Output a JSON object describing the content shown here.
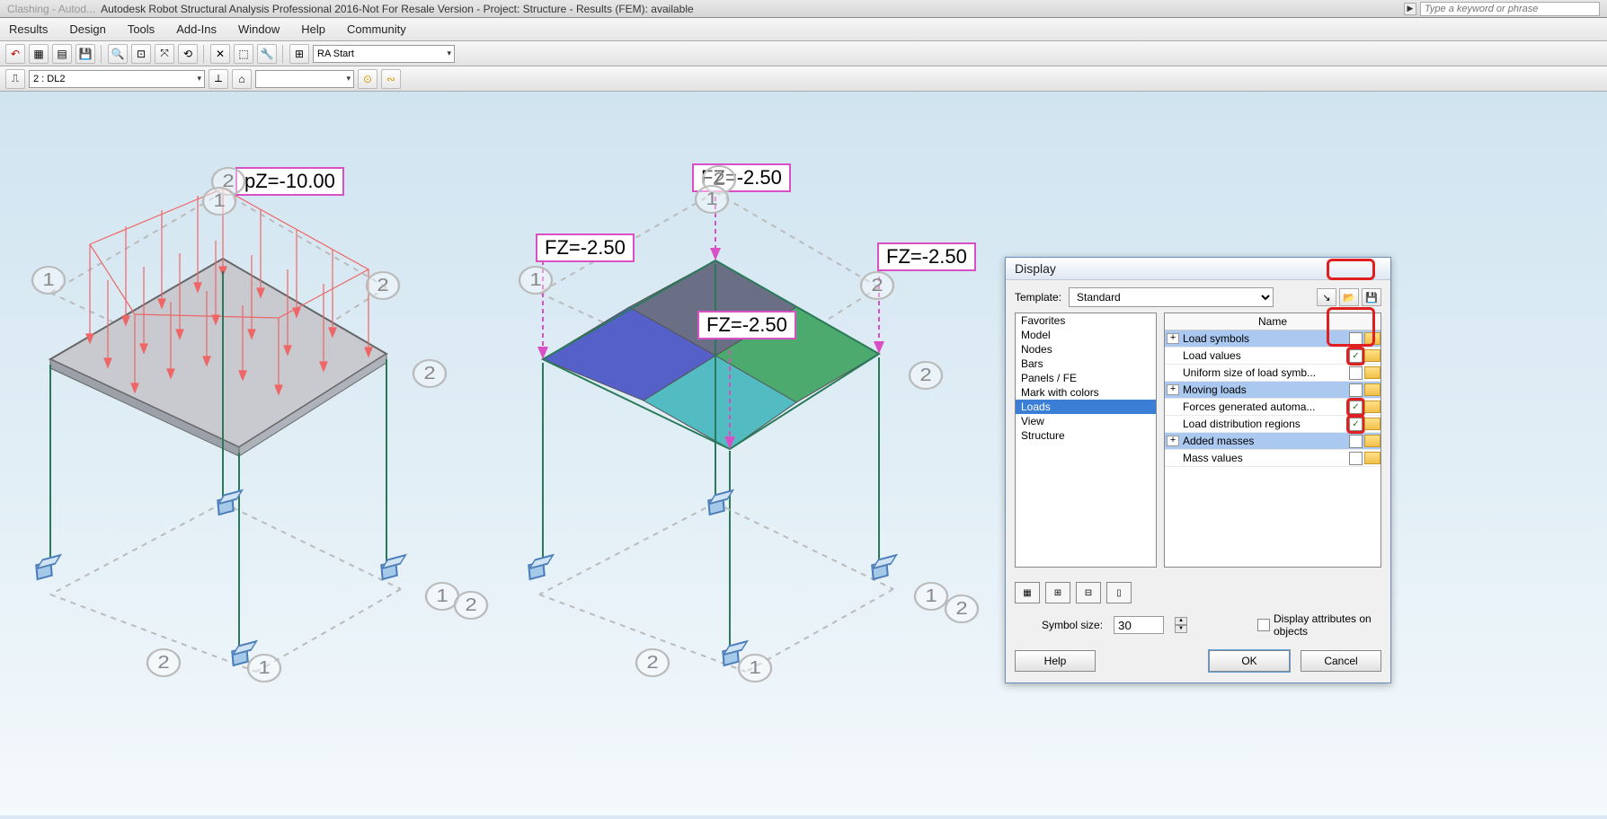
{
  "titlebar": {
    "faded": "Clashing - Autod...",
    "title": "Autodesk Robot Structural Analysis Professional 2016-Not For Resale Version - Project: Structure - Results (FEM): available",
    "keyword_ph": "Type a keyword or phrase"
  },
  "menu": {
    "m1": "Results",
    "m2": "Design",
    "m3": "Tools",
    "m4": "Add-Ins",
    "m5": "Window",
    "m6": "Help",
    "m7": "Community"
  },
  "toolbar1": {
    "combo": "RA Start"
  },
  "toolbar2": {
    "combo": "2 : DL2"
  },
  "labels": {
    "pz": "pZ=-10.00",
    "f1": "FZ=-2.50",
    "f2": "FZ=-2.50",
    "f3": "FZ=-2.50",
    "f4": "FZ=-2.50"
  },
  "axes": {
    "n1": "1",
    "n2": "2"
  },
  "dialog": {
    "title": "Display",
    "template_label": "Template:",
    "template_value": "Standard",
    "cats": {
      "c0": "Favorites",
      "c1": "Model",
      "c2": "Nodes",
      "c3": "Bars",
      "c4": "Panels / FE",
      "c5": "Mark with colors",
      "c6": "Loads",
      "c7": "View",
      "c8": "Structure"
    },
    "opt_header": "Name",
    "opts": {
      "o0": "Load symbols",
      "o1": "Load values",
      "o2": "Uniform size of load symb...",
      "o3": "Moving loads",
      "o4": "Forces generated automa...",
      "o5": "Load distribution regions",
      "o6": "Added masses",
      "o7": "Mass values"
    },
    "symbol_label": "Symbol size:",
    "symbol_value": "30",
    "disp_attr": "Display attributes on objects",
    "help": "Help",
    "ok": "OK",
    "cancel": "Cancel"
  }
}
